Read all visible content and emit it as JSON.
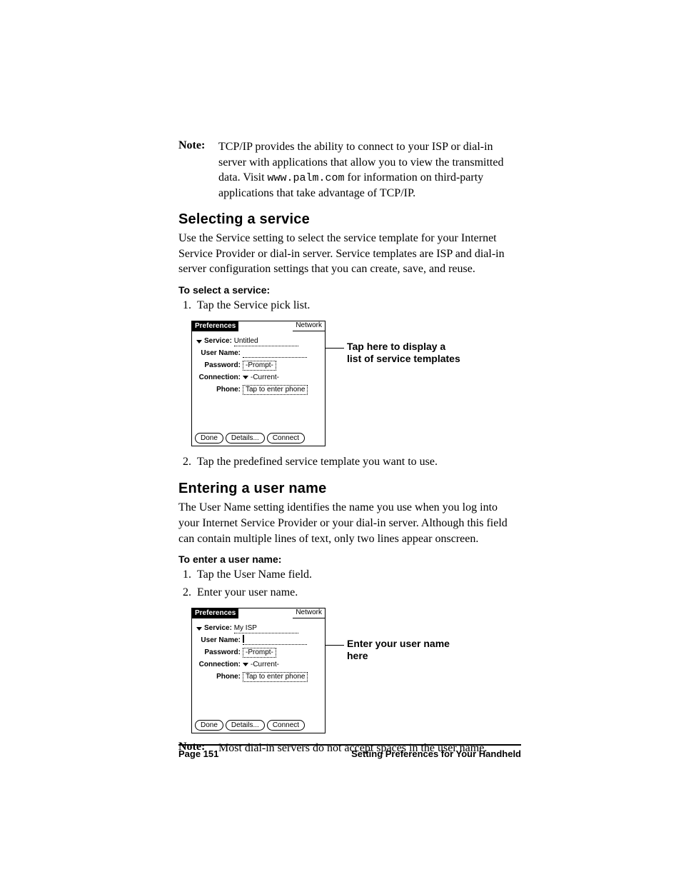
{
  "note1": {
    "label": "Note:",
    "text_a": "TCP/IP provides the ability to connect to your ISP or dial-in server with applications that allow you to view the transmitted data. Visit ",
    "url": "www.palm.com",
    "text_b": " for information on third-party applications that take advantage of TCP/IP."
  },
  "section1": {
    "title": "Selecting a service",
    "body": "Use the Service setting to select the service template for your Internet Service Provider or dial-in server. Service templates are ISP and dial-in server configuration settings that you can create, save, and reuse.",
    "subhead": "To select a service:",
    "step1": "Tap the Service pick list.",
    "step2": "Tap the predefined service template you want to use.",
    "callout": "Tap here to display a list of service templates"
  },
  "section2": {
    "title": "Entering a user name",
    "body": "The User Name setting identifies the name you use when you log into your Internet Service Provider or your dial-in server. Although this field can contain multiple lines of text, only two lines appear onscreen.",
    "subhead": "To enter a user name:",
    "step1": "Tap the User Name field.",
    "step2": "Enter your user name.",
    "callout": "Enter your user name here"
  },
  "note2": {
    "label": "Note:",
    "text": "Most dial-in servers do not accept spaces in the user name."
  },
  "palm": {
    "title": "Preferences",
    "menu": "Network",
    "labels": {
      "service": "Service:",
      "username": "User Name:",
      "password": "Password:",
      "connection": "Connection:",
      "phone": "Phone:"
    },
    "values1": {
      "service": "Untitled",
      "username": "",
      "password": "-Prompt-",
      "connection": "-Current-",
      "phone": "Tap to enter phone"
    },
    "values2": {
      "service": "My ISP",
      "username": "",
      "password": "-Prompt-",
      "connection": "-Current-",
      "phone": "Tap to enter phone"
    },
    "buttons": {
      "done": "Done",
      "details": "Details...",
      "connect": "Connect"
    }
  },
  "footer": {
    "left": "Page 151",
    "right": "Setting Preferences for Your Handheld"
  }
}
